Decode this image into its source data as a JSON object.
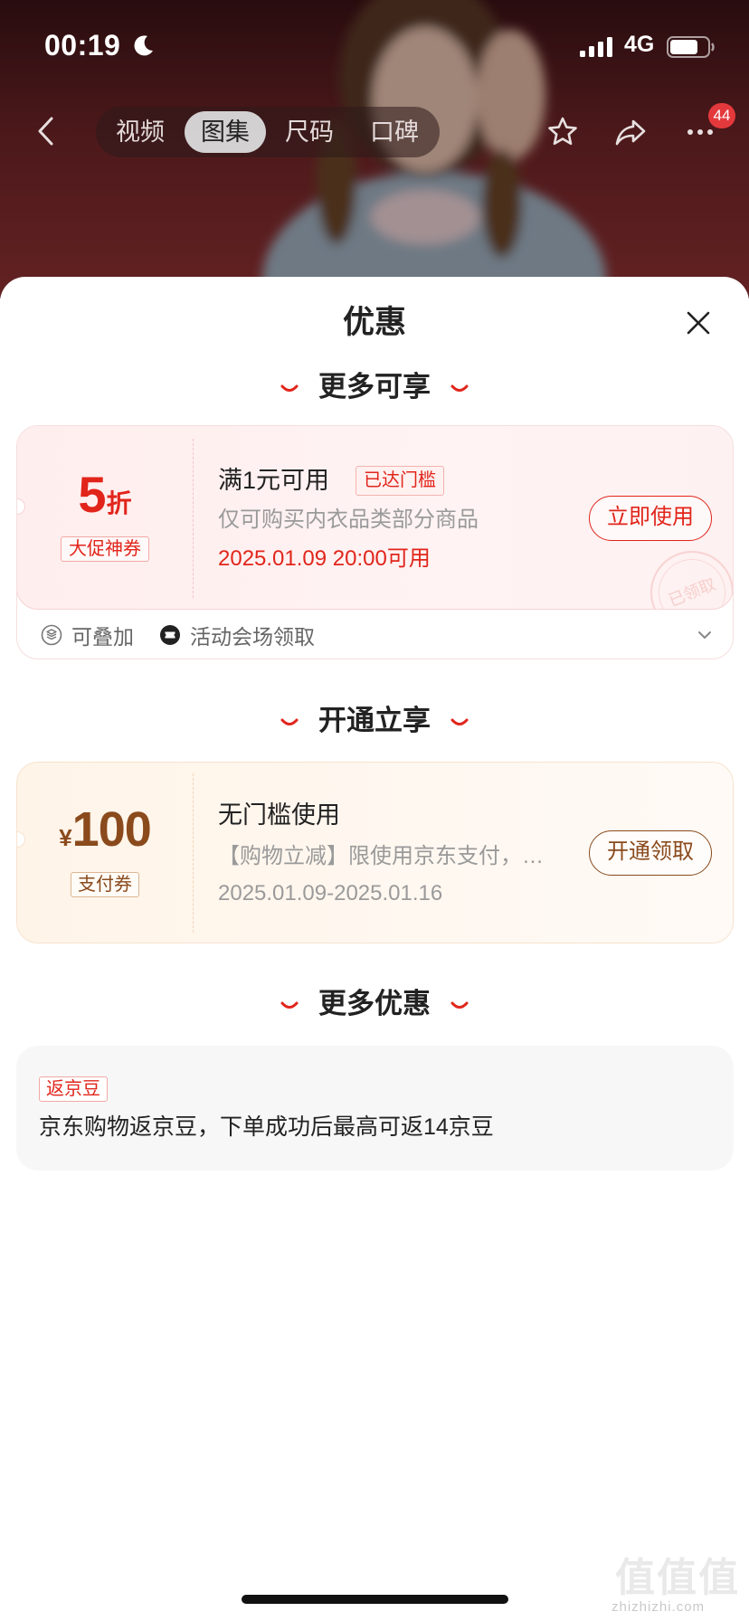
{
  "theme": {
    "red": "#e1251b",
    "brown": "#8a4a1c",
    "text": "#222222",
    "grey": "#9a9a9a"
  },
  "status_bar": {
    "time": "00:19",
    "focus_icon": "moon-icon",
    "network": "4G"
  },
  "nav": {
    "left_icon": "back-icon",
    "tabs": [
      {
        "label": "视频",
        "selected": false
      },
      {
        "label": "图集",
        "selected": true
      },
      {
        "label": "尺码",
        "selected": false
      },
      {
        "label": "口碑",
        "selected": false
      }
    ],
    "right_icons": [
      "star-icon",
      "share-icon",
      "more-icon"
    ],
    "more_badge": "44"
  },
  "sheet": {
    "title": "优惠",
    "close_icon": "close-icon"
  },
  "section_more_available": {
    "heading": "更多可享",
    "coupon": {
      "discount_value": "5",
      "discount_unit": "折",
      "tag": "大促神券",
      "condition": "满1元可用",
      "status_badge": "已达门槛",
      "scope": "仅可购买内衣品类部分商品",
      "valid_from": "2025.01.09 20:00可用",
      "action_label": "立即使用",
      "stamp": "已领取",
      "features": [
        "可叠加",
        "活动会场领取"
      ]
    }
  },
  "section_open_now": {
    "heading": "开通立享",
    "coupon": {
      "currency": "¥",
      "amount": "100",
      "tag": "支付券",
      "condition": "无门槛使用",
      "scope": "【购物立减】限使用京东支付，…",
      "validity": "2025.01.09-2025.01.16",
      "action_label": "开通领取"
    }
  },
  "section_more_offers": {
    "heading": "更多优惠",
    "badge": "返京豆",
    "text": "京东购物返京豆，下单成功后最高可返14京豆"
  },
  "watermark": {
    "logo": "值值值",
    "site": "zhizhizhi.com"
  }
}
